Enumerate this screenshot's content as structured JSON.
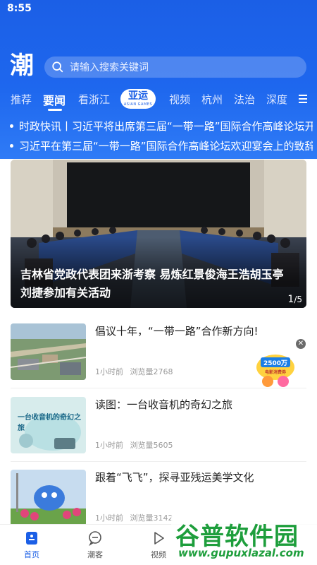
{
  "status_bar": {
    "time": "8:55"
  },
  "header": {
    "logo_text": "潮",
    "search_placeholder": "请输入搜索关键词"
  },
  "tabs": [
    {
      "label": "推荐"
    },
    {
      "label": "要闻"
    },
    {
      "label": "看浙江"
    },
    {
      "label": "视频"
    },
    {
      "label": "杭州"
    },
    {
      "label": "法治"
    },
    {
      "label": "深度"
    }
  ],
  "asia_games_badge": {
    "text": "亚运",
    "subtext": "ASIAN GAMES"
  },
  "ticker": [
    {
      "text": "时政快讯丨习近平将出席第三届“一带一路”国际合作高峰论坛开幕式"
    },
    {
      "text": "习近平在第三届“一带一路”国际合作高峰论坛欢迎宴会上的致辞"
    }
  ],
  "hero": {
    "title": "吉林省党政代表团来浙考察 易炼红景俊海王浩胡玉亭刘捷参加有关活动",
    "page_current": "1",
    "page_total": "/5"
  },
  "news": [
    {
      "title": "倡议十年，“一带一路”合作新方向!",
      "time": "1小时前",
      "views": "浏览量2768"
    },
    {
      "title": "读图：一台收音机的奇幻之旅",
      "time": "1小时前",
      "views": "浏览量5605",
      "thumb_text": "一台收音机的奇幻之旅"
    },
    {
      "title": "跟着“飞飞”，探寻亚残运美学文化",
      "time": "1小时前",
      "views": "浏览量3142"
    }
  ],
  "promo": {
    "amount": "2500万",
    "label": "电影消费券"
  },
  "bottom_nav": [
    {
      "label": "首页",
      "icon": "home-icon"
    },
    {
      "label": "潮客",
      "icon": "chat-icon"
    },
    {
      "label": "视频",
      "icon": "play-icon"
    }
  ],
  "watermark": {
    "name": "谷普软件园",
    "url": "www.gupuxlazal.com"
  },
  "colors": {
    "brand_blue": "#1b5fe6",
    "header_gradient_end": "#2f7bf6"
  }
}
